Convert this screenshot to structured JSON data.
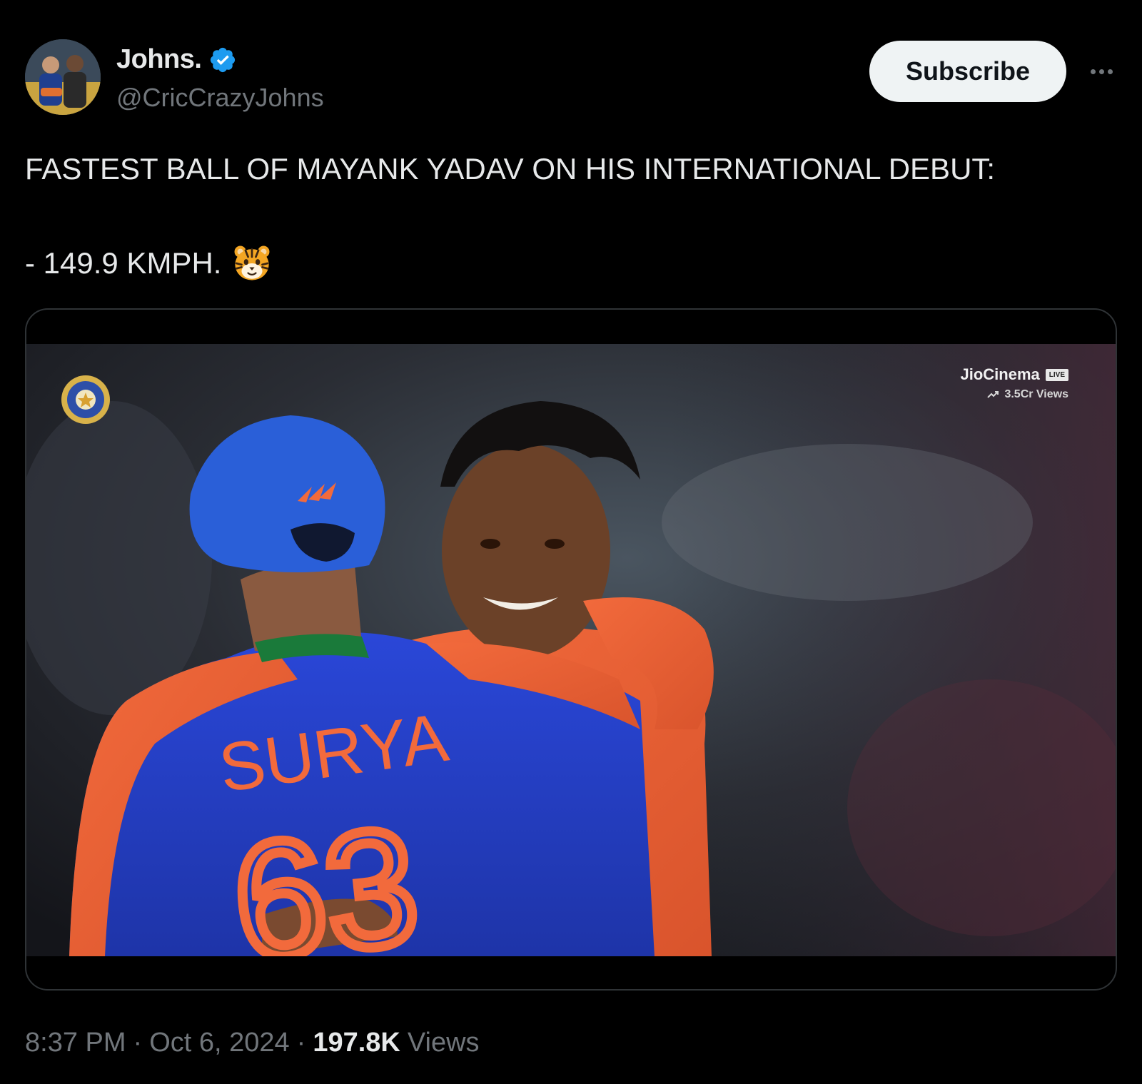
{
  "author": {
    "display_name": "Johns.",
    "handle": "@CricCrazyJohns",
    "verified": true,
    "accent_color": "#1d9bf0"
  },
  "actions": {
    "subscribe_label": "Subscribe",
    "more_icon": "more-horizontal-icon"
  },
  "tweet": {
    "line1": "FASTEST BALL OF MAYANK YADAV ON HIS INTERNATIONAL DEBUT:",
    "line2": "- 149.9 KMPH.",
    "emoji": "tiger-face-emoji"
  },
  "media": {
    "overlay_brand": "JioCinema",
    "overlay_live": "LIVE",
    "overlay_views": "3.5Cr Views",
    "jersey_name": "SURYA",
    "jersey_number": "63"
  },
  "meta": {
    "time": "8:37 PM",
    "date": "Oct 6, 2024",
    "views_count": "197.8K",
    "views_label": "Views",
    "separator": "·"
  },
  "colors": {
    "background": "#000000",
    "text_primary": "#e7e9ea",
    "text_secondary": "#71767b",
    "border": "#2f3336",
    "button_bg": "#eff3f4"
  }
}
